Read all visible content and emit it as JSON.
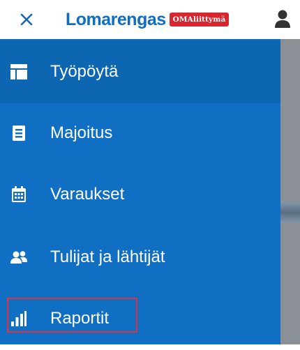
{
  "header": {
    "logo_text": "Lomarengas",
    "logo_badge": "OMAliittymä",
    "close_icon": "close-icon",
    "user_icon": "user-icon"
  },
  "nav": {
    "items": [
      {
        "label": "Työpöytä",
        "icon": "dashboard-icon",
        "active": true
      },
      {
        "label": "Majoitus",
        "icon": "document-icon",
        "active": false
      },
      {
        "label": "Varaukset",
        "icon": "calendar-icon",
        "active": false
      },
      {
        "label": "Tulijat ja lähtijät",
        "icon": "users-icon",
        "active": false
      },
      {
        "label": "Raportit",
        "icon": "bar-chart-icon",
        "active": false,
        "highlighted": true
      }
    ]
  },
  "colors": {
    "drawer_bg": "#106fc2",
    "active_bg": "#0d66b2",
    "brand_blue": "#0e6ec3",
    "badge_red": "#d72630",
    "highlight_red": "#e03240"
  }
}
